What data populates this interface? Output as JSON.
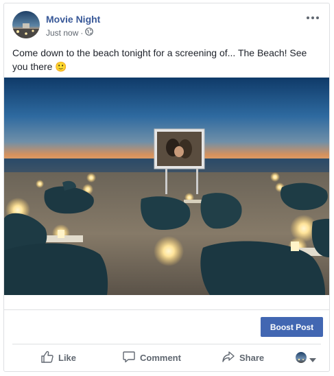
{
  "post": {
    "page_name": "Movie Night",
    "timestamp": "Just now",
    "separator": "·",
    "privacy_icon": "globe-icon",
    "caption": "Come down to the beach tonight for a screening of... The Beach! See you there",
    "emoji": "🙂"
  },
  "boost": {
    "label": "Boost Post"
  },
  "actions": {
    "like": "Like",
    "comment": "Comment",
    "share": "Share"
  },
  "colors": {
    "link": "#385898",
    "button": "#4267b2",
    "muted": "#606770",
    "border": "#dddfe2"
  }
}
